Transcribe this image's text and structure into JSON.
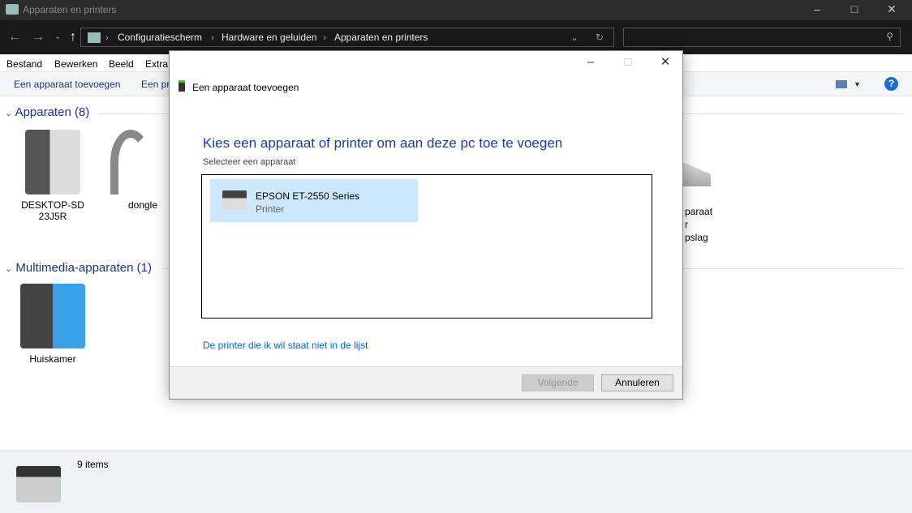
{
  "window": {
    "title": "Apparaten en printers"
  },
  "nav": {
    "breadcrumb": [
      "Configuratiescherm",
      "Hardware en geluiden",
      "Apparaten en printers"
    ]
  },
  "menu": [
    "Bestand",
    "Bewerken",
    "Beeld",
    "Extra"
  ],
  "commands": [
    "Een apparaat toevoegen",
    "Een pri"
  ],
  "groups": [
    {
      "label": "Apparaten (8)"
    },
    {
      "label": "Multimedia-apparaten (1)"
    }
  ],
  "devices": [
    {
      "label": "DESKTOP-SD23J5R"
    },
    {
      "label": "dongle"
    },
    {
      "label_lines": [
        "paraat",
        "r",
        "pslag"
      ]
    }
  ],
  "media": [
    {
      "label": "Huiskamer"
    }
  ],
  "status": {
    "count": "9 items"
  },
  "dialog": {
    "title": "Een apparaat toevoegen",
    "heading": "Kies een apparaat of printer om aan deze pc toe te voegen",
    "subheading": "Selecteer een apparaat",
    "items": [
      {
        "name": "EPSON ET-2550 Series",
        "type": "Printer"
      }
    ],
    "link": "De printer die ik wil staat niet in de lijst",
    "next": "Volgende",
    "cancel": "Annuleren"
  }
}
